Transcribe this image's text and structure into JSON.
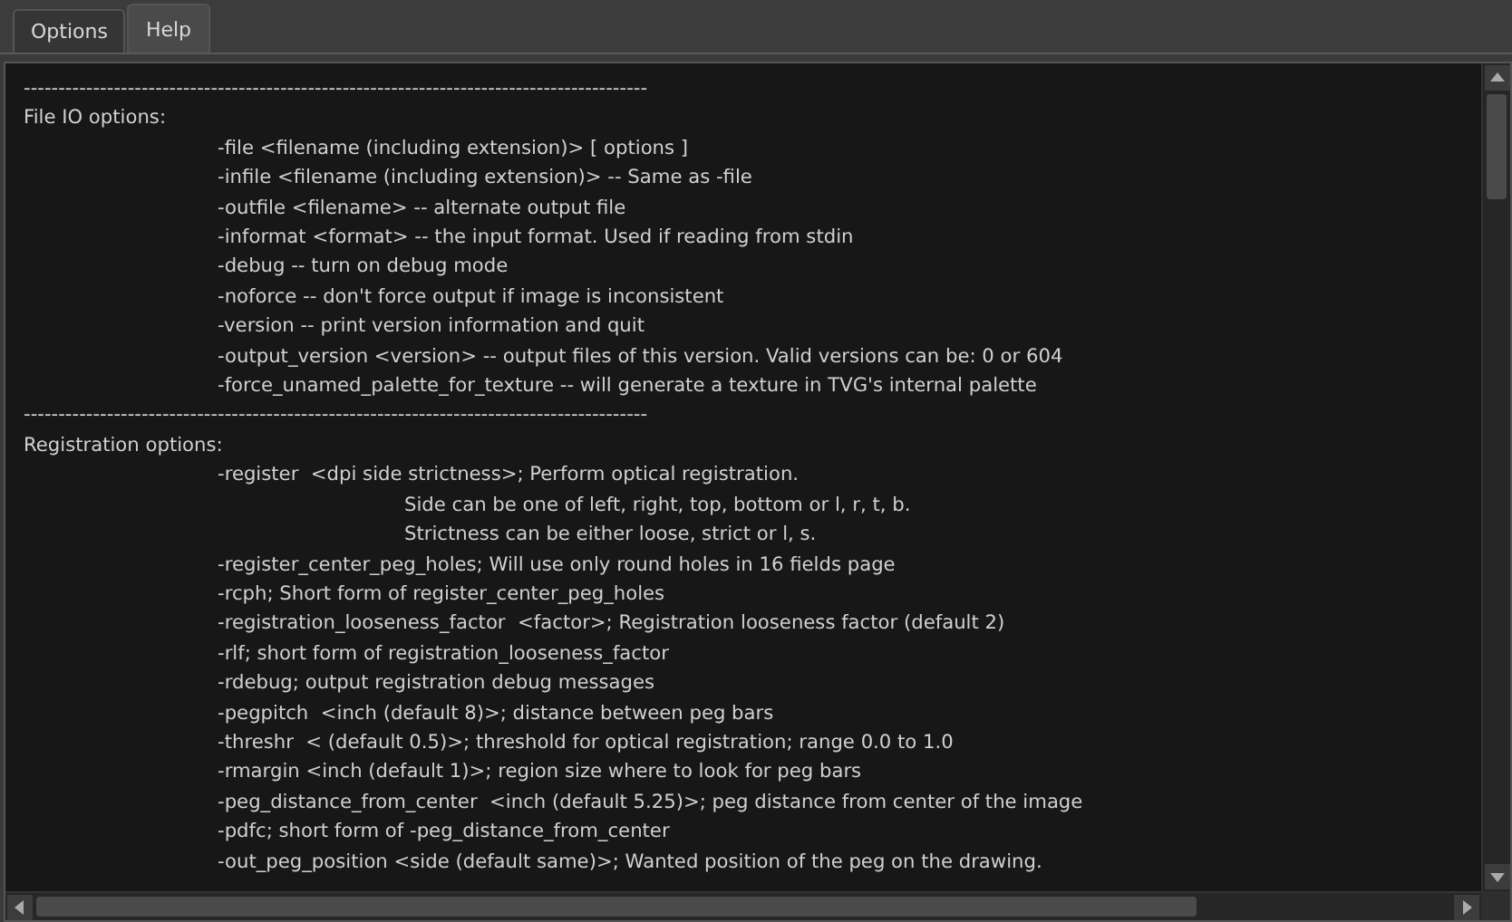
{
  "tabs": [
    {
      "label": "Options",
      "selected": false
    },
    {
      "label": "Help",
      "selected": true
    }
  ],
  "help_text": {
    "lines": [
      {
        "kind": "rule",
        "text": "------------------------------------------------------------------------------------------"
      },
      {
        "kind": "heading",
        "text": "File IO options:"
      },
      {
        "kind": "option",
        "text": "-file <filename (including extension)> [ options ]"
      },
      {
        "kind": "option",
        "text": "-infile <filename (including extension)> -- Same as -file"
      },
      {
        "kind": "option",
        "text": "-outfile <filename> -- alternate output file"
      },
      {
        "kind": "option",
        "text": "-informat <format> -- the input format. Used if reading from stdin"
      },
      {
        "kind": "option",
        "text": "-debug -- turn on debug mode"
      },
      {
        "kind": "option",
        "text": "-noforce -- don't force output if image is inconsistent"
      },
      {
        "kind": "option",
        "text": "-version -- print version information and quit"
      },
      {
        "kind": "option",
        "text": "-output_version <version> -- output files of this version. Valid versions can be: 0 or 604"
      },
      {
        "kind": "option",
        "text": "-force_unamed_palette_for_texture -- will generate a texture in TVG's internal palette"
      },
      {
        "kind": "rule",
        "text": "------------------------------------------------------------------------------------------"
      },
      {
        "kind": "heading",
        "text": "Registration options:"
      },
      {
        "kind": "option",
        "text": "-register  <dpi side strictness>; Perform optical registration."
      },
      {
        "kind": "continuation",
        "text": "Side can be one of left, right, top, bottom or l, r, t, b."
      },
      {
        "kind": "continuation",
        "text": "Strictness can be either loose, strict or l, s."
      },
      {
        "kind": "option",
        "text": "-register_center_peg_holes; Will use only round holes in 16 fields page"
      },
      {
        "kind": "option",
        "text": "-rcph; Short form of register_center_peg_holes"
      },
      {
        "kind": "option",
        "text": "-registration_looseness_factor  <factor>; Registration looseness factor (default 2)"
      },
      {
        "kind": "option",
        "text": "-rlf; short form of registration_looseness_factor"
      },
      {
        "kind": "option",
        "text": "-rdebug; output registration debug messages"
      },
      {
        "kind": "option",
        "text": "-pegpitch  <inch (default 8)>; distance between peg bars"
      },
      {
        "kind": "option",
        "text": "-threshr  < (default 0.5)>; threshold for optical registration; range 0.0 to 1.0"
      },
      {
        "kind": "option",
        "text": "-rmargin <inch (default 1)>; region size where to look for peg bars"
      },
      {
        "kind": "option",
        "text": "-peg_distance_from_center  <inch (default 5.25)>; peg distance from center of the image"
      },
      {
        "kind": "option",
        "text": "-pdfc; short form of -peg_distance_from_center"
      },
      {
        "kind": "option",
        "text": "-out_peg_position <side (default same)>; Wanted position of the peg on the drawing."
      }
    ]
  }
}
